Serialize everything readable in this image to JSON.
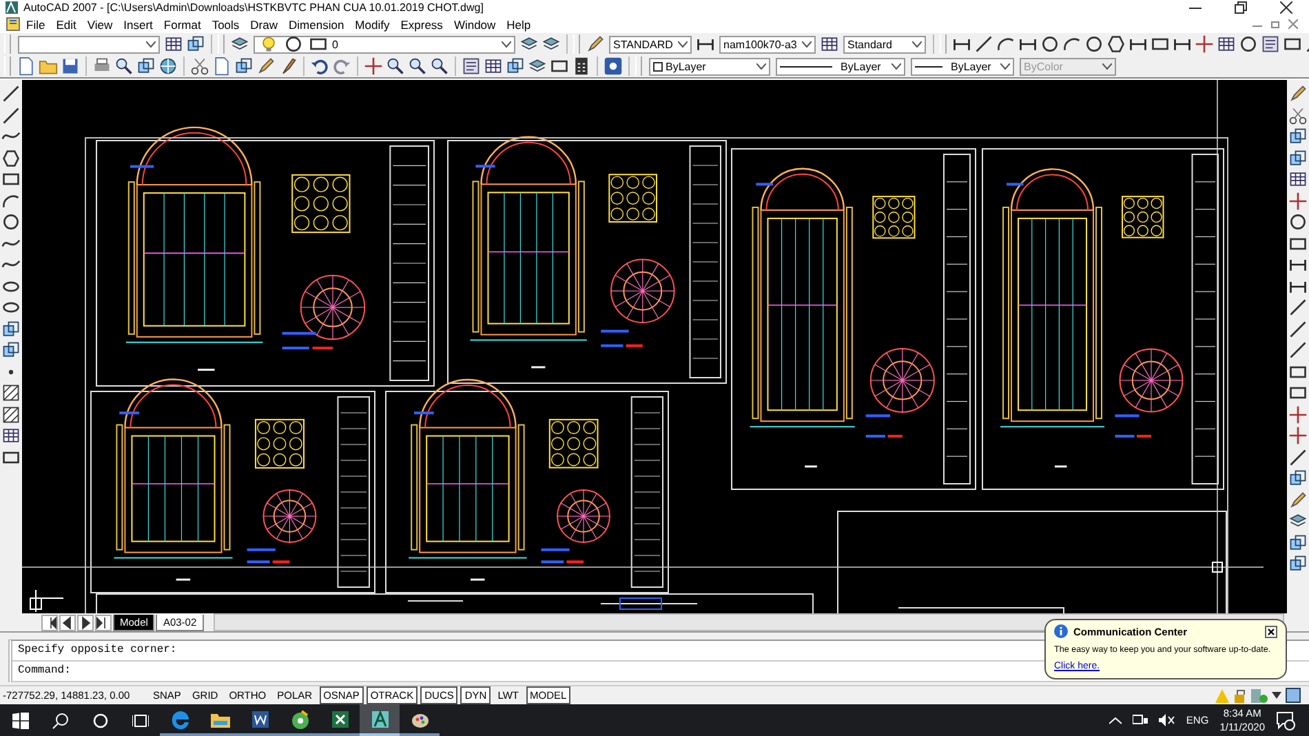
{
  "window": {
    "title": "AutoCAD 2007 - [C:\\Users\\Admin\\Downloads\\HSTKBVTC PHAN CUA 10.01.2019 CHOT.dwg]"
  },
  "menu": [
    "File",
    "Edit",
    "View",
    "Insert",
    "Format",
    "Tools",
    "Draw",
    "Dimension",
    "Modify",
    "Express",
    "Window",
    "Help"
  ],
  "toolbars": {
    "layer": "0",
    "text_style": "STANDARD",
    "dim_style": "nam100k70-a3",
    "table_style": "Standard",
    "color_control": "ByLayer",
    "linetype": "ByLayer",
    "lineweight": "ByLayer",
    "plot_style": {
      "value": "ByColor",
      "disabled": true
    }
  },
  "layout_tabs": [
    {
      "label": "Model",
      "selected": true
    },
    {
      "label": "A03-02",
      "selected": false
    }
  ],
  "command_lines": [
    "Specify opposite corner:",
    "Command:"
  ],
  "status_bar": {
    "coordinates": "-727752.29, 14881.23, 0.00",
    "toggles": [
      {
        "label": "SNAP",
        "on": false
      },
      {
        "label": "GRID",
        "on": false
      },
      {
        "label": "ORTHO",
        "on": false
      },
      {
        "label": "POLAR",
        "on": false
      },
      {
        "label": "OSNAP",
        "on": true
      },
      {
        "label": "OTRACK",
        "on": true
      },
      {
        "label": "DUCS",
        "on": true
      },
      {
        "label": "DYN",
        "on": true
      },
      {
        "label": "LWT",
        "on": false
      },
      {
        "label": "MODEL",
        "on": true
      }
    ]
  },
  "balloon": {
    "title": "Communication Center",
    "message": "The easy way to keep you and your software up-to-date.",
    "link": "Click here."
  },
  "taskbar": {
    "apps": [
      {
        "kind": "browser",
        "selected": false
      },
      {
        "kind": "files",
        "selected": false
      },
      {
        "kind": "word",
        "selected": false
      },
      {
        "kind": "disc",
        "selected": false
      },
      {
        "kind": "sheet",
        "selected": false
      },
      {
        "kind": "cad",
        "selected": true
      },
      {
        "kind": "paint",
        "selected": false
      }
    ],
    "language": "ENG",
    "time": "8:34 AM",
    "date": "1/11/2020"
  }
}
